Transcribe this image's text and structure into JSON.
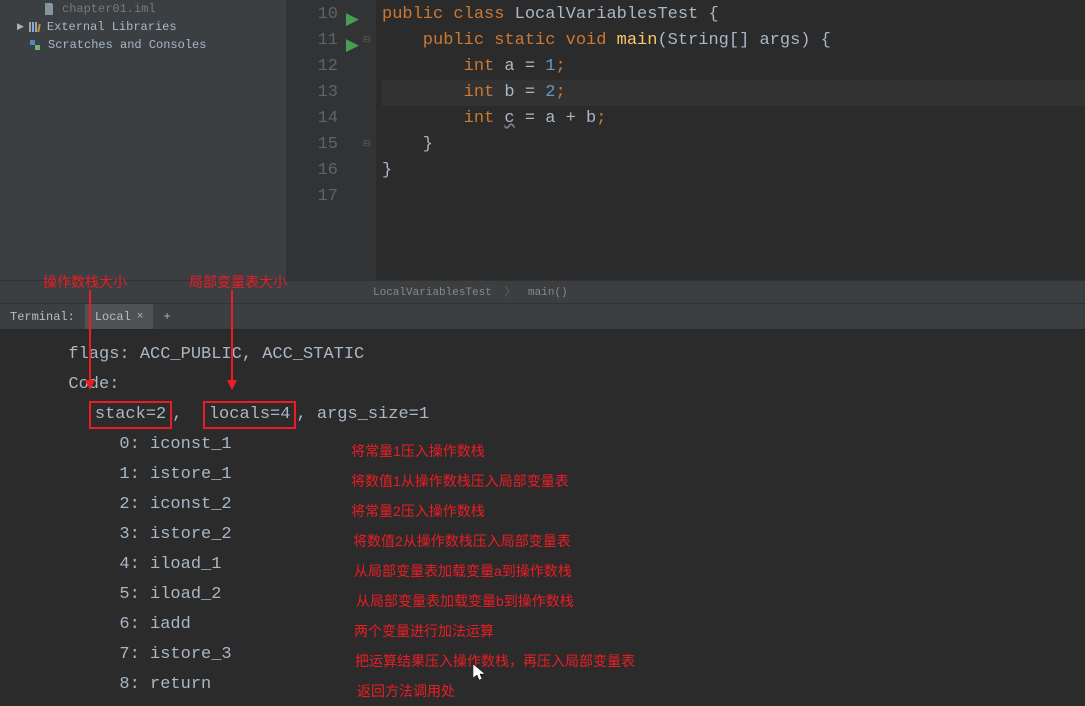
{
  "sidebar": {
    "items": [
      {
        "icon": "file",
        "label": "chapter01.iml",
        "color": "#787878"
      },
      {
        "icon": "lib",
        "label": "External Libraries",
        "color": "#bbbbbb"
      },
      {
        "icon": "scratch",
        "label": "Scratches and Consoles",
        "color": "#bbbbbb"
      }
    ]
  },
  "editor": {
    "lines": [
      {
        "num": 10,
        "arrow": true,
        "code": [
          {
            "t": "public class ",
            "c": "kw"
          },
          {
            "t": "LocalVariablesTest {",
            "c": "str"
          }
        ]
      },
      {
        "num": 11,
        "arrow": true,
        "fold": "⊟",
        "code": [
          {
            "t": "    public static void ",
            "c": "kw"
          },
          {
            "t": "main",
            "c": "fn"
          },
          {
            "t": "(String[] args) {",
            "c": "str"
          }
        ]
      },
      {
        "num": 12,
        "code": [
          {
            "t": "        int ",
            "c": "kw"
          },
          {
            "t": "a = ",
            "c": "str"
          },
          {
            "t": "1",
            "c": "num"
          },
          {
            "t": ";",
            "c": "semi"
          }
        ]
      },
      {
        "num": 13,
        "highlight": true,
        "code": [
          {
            "t": "        int ",
            "c": "kw"
          },
          {
            "t": "b = ",
            "c": "str"
          },
          {
            "t": "2",
            "c": "num"
          },
          {
            "t": ";",
            "c": "semi"
          }
        ]
      },
      {
        "num": 14,
        "code": [
          {
            "t": "        int ",
            "c": "kw"
          },
          {
            "t": "c",
            "c": "underline"
          },
          {
            "t": " = a + b",
            "c": "str"
          },
          {
            "t": ";",
            "c": "semi"
          }
        ]
      },
      {
        "num": 15,
        "fold": "⊟",
        "code": [
          {
            "t": "    }",
            "c": "str"
          }
        ]
      },
      {
        "num": 16,
        "code": [
          {
            "t": "}",
            "c": "str"
          }
        ]
      },
      {
        "num": 17,
        "code": []
      }
    ]
  },
  "breadcrumb": {
    "a": "LocalVariablesTest",
    "b": "main()"
  },
  "tabs": {
    "label_terminal": "Terminal:",
    "label_local": "Local",
    "plus": "+"
  },
  "terminal": {
    "flags": "  flags: ACC_PUBLIC, ACC_STATIC",
    "code": "  Code:",
    "stack": "stack=2",
    "comma": ",",
    "locals": "locals=4",
    "rest": ", args_size=1",
    "instructions": [
      {
        "line": "       0: iconst_1",
        "note": "将常量1压入操作数栈",
        "nx": 351
      },
      {
        "line": "       1: istore_1",
        "note": "将数值1从操作数栈压入局部变量表",
        "nx": 351
      },
      {
        "line": "       2: iconst_2",
        "note": "将常量2压入操作数栈",
        "nx": 351
      },
      {
        "line": "       3: istore_2",
        "note": "将数值2从操作数栈压入局部变量表",
        "nx": 353
      },
      {
        "line": "       4: iload_1",
        "note": "从局部变量表加载变量a到操作数栈",
        "nx": 354
      },
      {
        "line": "       5: iload_2",
        "note": "从局部变量表加载变量b到操作数栈",
        "nx": 356
      },
      {
        "line": "       6: iadd",
        "note": "两个变量进行加法运算",
        "nx": 354
      },
      {
        "line": "       7: istore_3",
        "note": "把运算结果压入操作数栈，再压入局部变量表",
        "nx": 355
      },
      {
        "line": "       8: return",
        "note": "返回方法调用处",
        "nx": 357
      }
    ]
  },
  "annotations": {
    "stack_label": "操作数栈大小",
    "locals_label": "局部变量表大小"
  }
}
